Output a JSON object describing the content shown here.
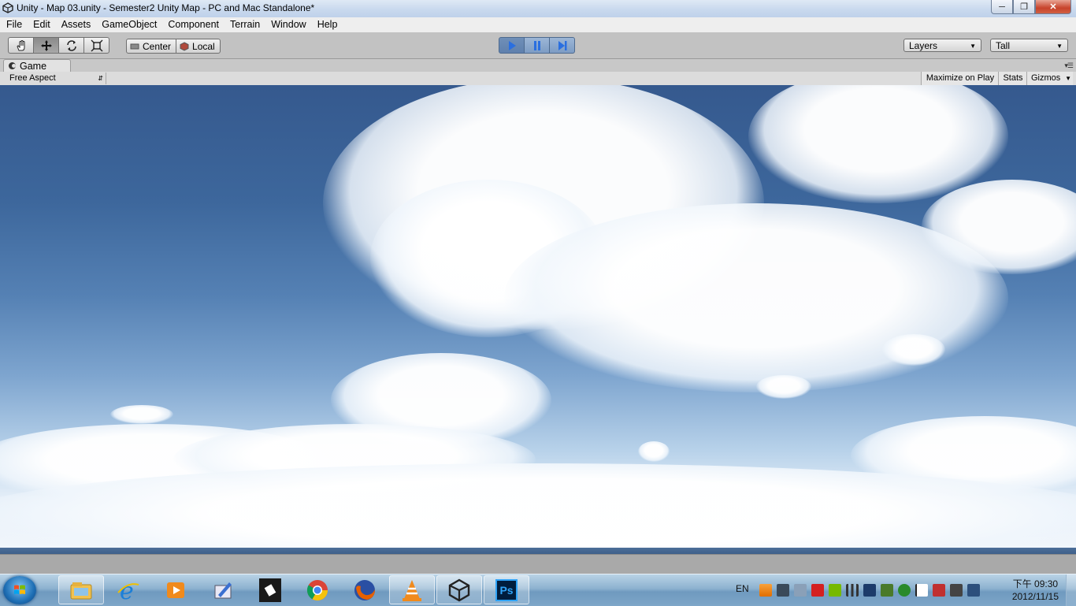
{
  "window": {
    "title": "Unity - Map 03.unity - Semester2 Unity Map - PC and Mac Standalone*",
    "controls": [
      "minimize",
      "maximize",
      "close"
    ]
  },
  "menu": [
    "File",
    "Edit",
    "Assets",
    "GameObject",
    "Component",
    "Terrain",
    "Window",
    "Help"
  ],
  "toolbar": {
    "transform_tools": [
      "hand-icon",
      "move-icon",
      "rotate-icon",
      "scale-icon"
    ],
    "active_tool": "move-icon",
    "pivot": {
      "center_label": "Center",
      "local_label": "Local"
    },
    "playback": [
      "play-icon",
      "pause-icon",
      "step-icon"
    ],
    "layers_label": "Layers",
    "layout_label": "Tall"
  },
  "game_view": {
    "tab_label": "Game",
    "aspect_label": "Free Aspect",
    "maximize_label": "Maximize on Play",
    "stats_label": "Stats",
    "gizmos_label": "Gizmos"
  },
  "taskbar": {
    "apps": [
      "explorer-icon",
      "internet-explorer-icon",
      "media-player-icon",
      "paint-tool-icon",
      "app-icon",
      "chrome-icon",
      "firefox-icon",
      "vlc-icon",
      "unity-icon",
      "photoshop-icon"
    ],
    "photoshop_label": "Ps",
    "language": "EN",
    "clock_time": "下午 09:30",
    "clock_date": "2012/11/15"
  },
  "colors": {
    "sky_top": "#35598e",
    "sky_horizon": "#f3f7fc",
    "toolbar_bg": "#c2c2c2",
    "play_active": "#5f80ad"
  }
}
